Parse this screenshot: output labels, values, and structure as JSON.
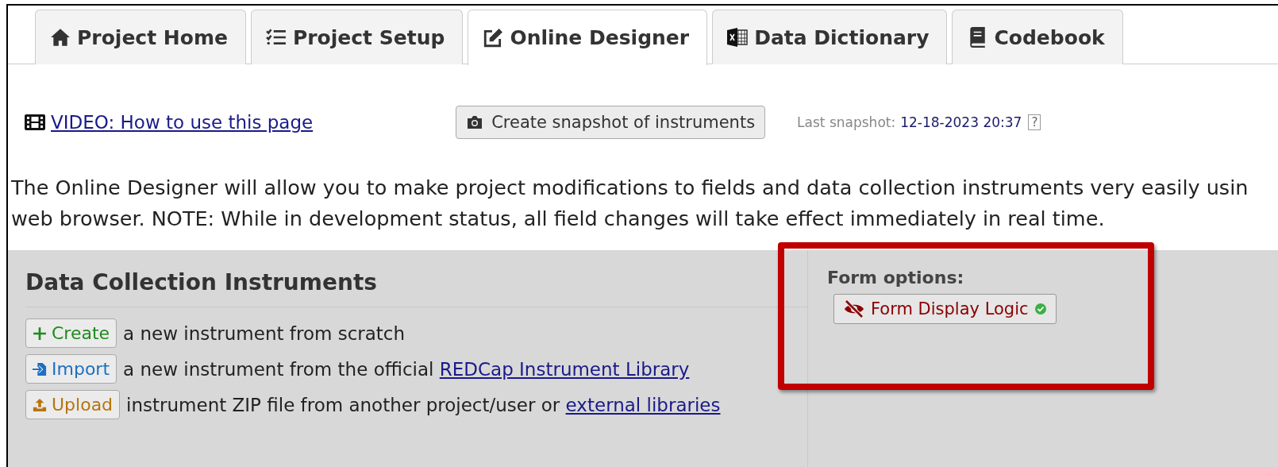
{
  "tabs": [
    {
      "label": "Project Home",
      "kind": "home",
      "selected": false
    },
    {
      "label": "Project Setup",
      "kind": "setup",
      "selected": false
    },
    {
      "label": "Online Designer",
      "kind": "designer",
      "selected": true
    },
    {
      "label": "Data Dictionary",
      "kind": "dictionary",
      "selected": false
    },
    {
      "label": "Codebook",
      "kind": "codebook",
      "selected": false
    }
  ],
  "video_link": "VIDEO: How to use this page",
  "snapshot_button": "Create snapshot of instruments",
  "last_snapshot": {
    "label": "Last snapshot:",
    "value": "12-18-2023 20:37",
    "help": "?"
  },
  "intro": [
    "The Online Designer will allow you to make project modifications to fields and data collection instruments very easily usin",
    "web browser. NOTE: While in development status, all field changes will take effect immediately in real time."
  ],
  "instruments": {
    "title": "Data Collection Instruments",
    "actions": [
      {
        "kind": "create",
        "label": "Create",
        "text": "a new instrument from scratch"
      },
      {
        "kind": "import",
        "label": "Import",
        "text": "a new instrument from the official",
        "link": "REDCap Instrument Library"
      },
      {
        "kind": "upload",
        "label": "Upload",
        "text": "instrument ZIP file from another project/user or",
        "link": "external libraries"
      }
    ]
  },
  "form_options": {
    "title": "Form options:",
    "button": "Form Display Logic",
    "active": true
  },
  "highlight": true
}
